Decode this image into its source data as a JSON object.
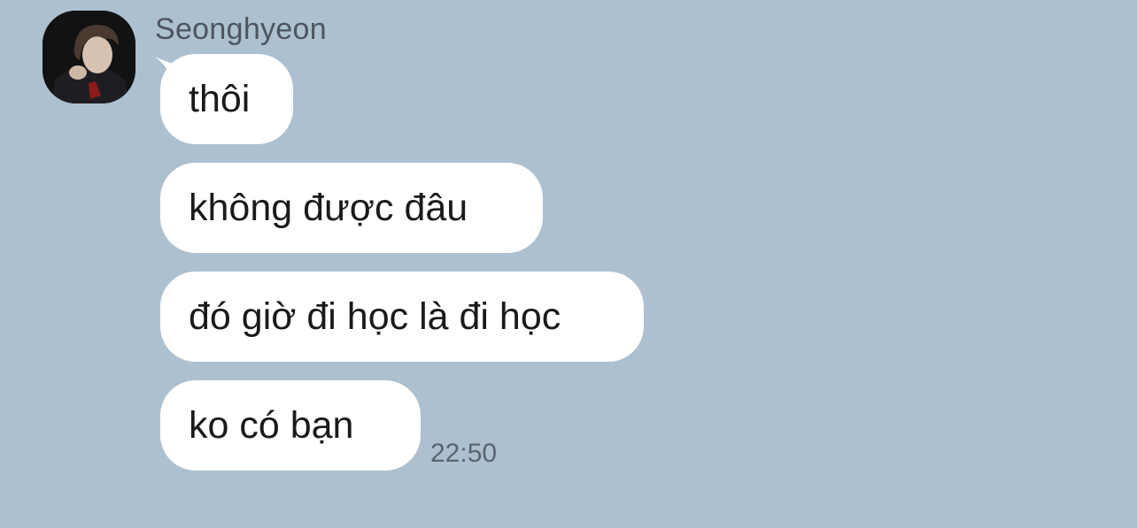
{
  "chat": {
    "sender": {
      "name": "Seonghyeon",
      "avatar_icon": "profile-photo"
    },
    "messages": [
      {
        "text": "thôi"
      },
      {
        "text": "không được đâu"
      },
      {
        "text": "đó giờ đi học là đi học"
      },
      {
        "text": "ko có bạn"
      }
    ],
    "last_message_time": "22:50"
  },
  "colors": {
    "background": "#adc0d0",
    "bubble": "#ffffff",
    "message_text": "#1a1a1a",
    "name_text": "#4d5560",
    "timestamp_text": "#5a6470"
  }
}
